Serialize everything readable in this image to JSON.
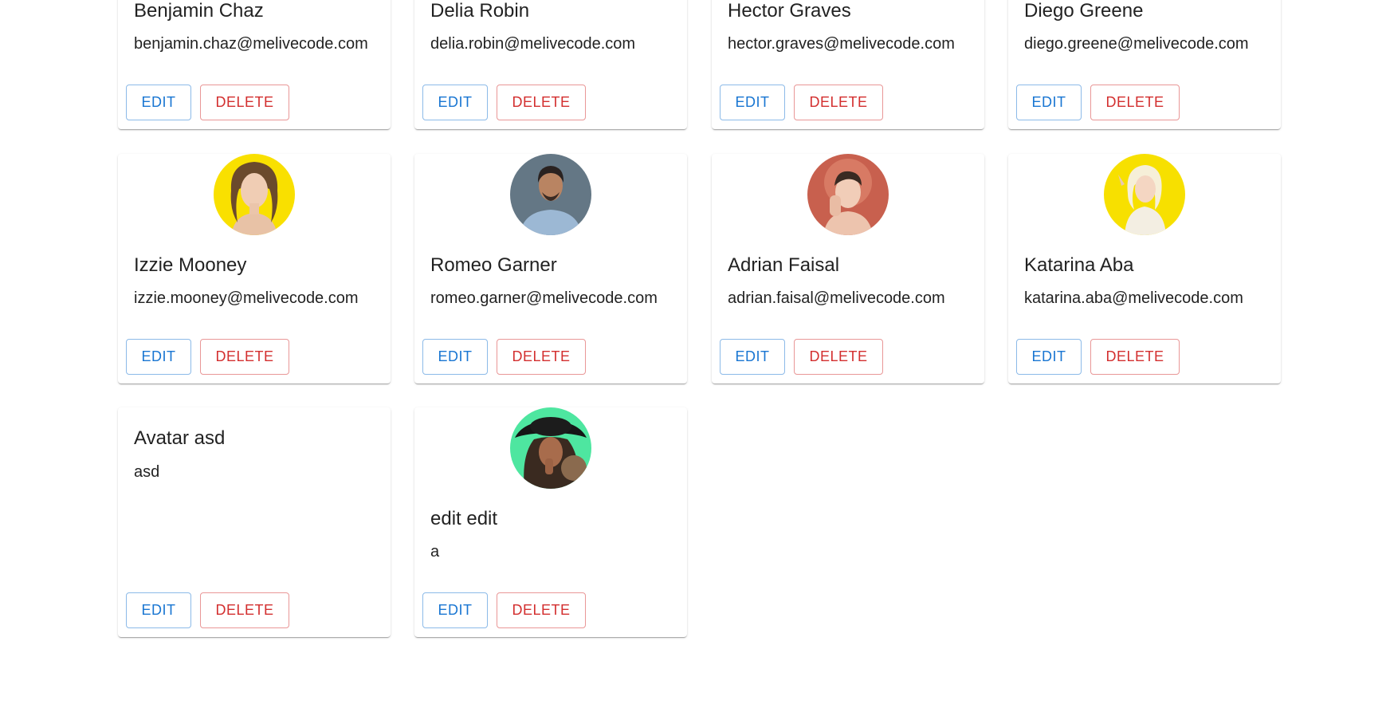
{
  "buttons": {
    "edit": "EDIT",
    "delete": "DELETE"
  },
  "users": [
    {
      "name": "Benjamin Chaz",
      "email": "benjamin.chaz@melivecode.com"
    },
    {
      "name": "Delia Robin",
      "email": "delia.robin@melivecode.com"
    },
    {
      "name": "Hector Graves",
      "email": "hector.graves@melivecode.com"
    },
    {
      "name": "Diego Greene",
      "email": "diego.greene@melivecode.com"
    },
    {
      "name": "Izzie Mooney",
      "email": "izzie.mooney@melivecode.com",
      "avatar_bg": "#f9e000"
    },
    {
      "name": "Romeo Garner",
      "email": "romeo.garner@melivecode.com",
      "avatar_bg": "#647785"
    },
    {
      "name": "Adrian Faisal",
      "email": "adrian.faisal@melivecode.com",
      "avatar_bg": "#c8604e"
    },
    {
      "name": "Katarina Aba",
      "email": "katarina.aba@melivecode.com",
      "avatar_bg": "#f7e000"
    },
    {
      "name": "Avatar asd",
      "email": "asd"
    },
    {
      "name": "edit edit",
      "email": "a",
      "avatar_bg": "#4ee6a0"
    }
  ]
}
